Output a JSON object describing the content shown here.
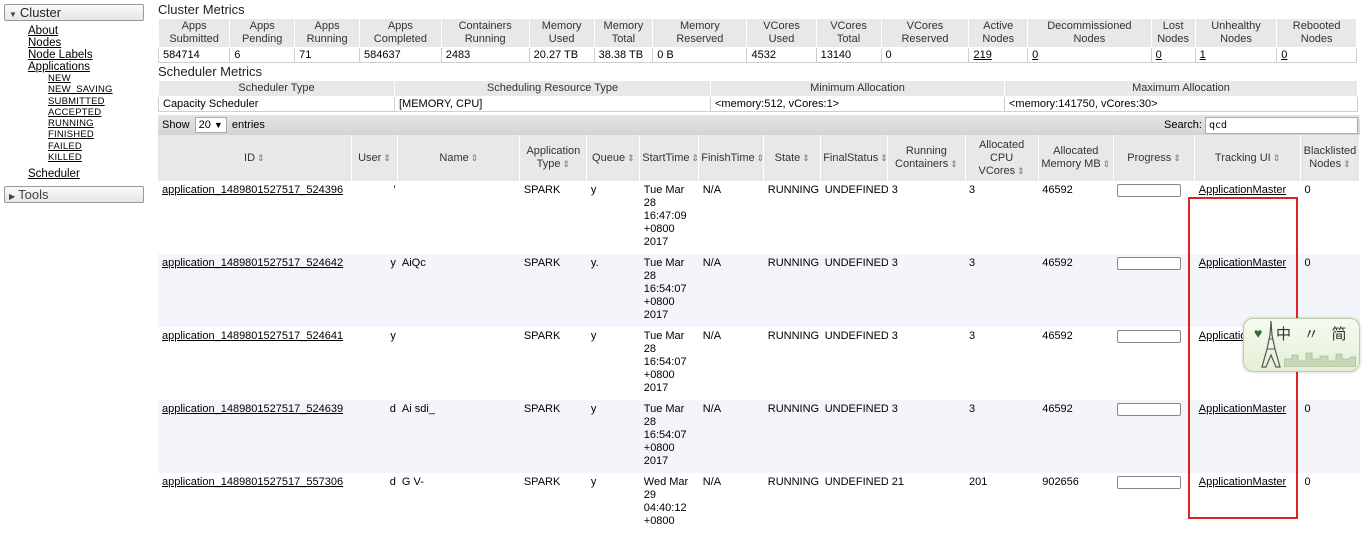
{
  "sidebar": {
    "cluster_label": "Cluster",
    "links": [
      "About",
      "Nodes",
      "Node Labels",
      "Applications"
    ],
    "app_states": [
      "NEW",
      "NEW_SAVING",
      "SUBMITTED",
      "ACCEPTED",
      "RUNNING",
      "FINISHED",
      "FAILED",
      "KILLED"
    ],
    "scheduler_link": "Scheduler",
    "tools_label": "Tools"
  },
  "cluster_metrics": {
    "title": "Cluster Metrics",
    "headers": [
      "Apps Submitted",
      "Apps Pending",
      "Apps Running",
      "Apps Completed",
      "Containers Running",
      "Memory Used",
      "Memory Total",
      "Memory Reserved",
      "VCores Used",
      "VCores Total",
      "VCores Reserved",
      "Active Nodes",
      "Decommissioned Nodes",
      "Lost Nodes",
      "Unhealthy Nodes",
      "Rebooted Nodes"
    ],
    "values": [
      "584714",
      "6",
      "71",
      "584637",
      "2483",
      "20.27 TB",
      "38.38 TB",
      "0 B",
      "4532",
      "13140",
      "0",
      "219",
      "0",
      "0",
      "1",
      "0"
    ]
  },
  "scheduler_metrics": {
    "title": "Scheduler Metrics",
    "headers": [
      "Scheduler Type",
      "Scheduling Resource Type",
      "Minimum Allocation",
      "Maximum Allocation"
    ],
    "values": [
      "Capacity Scheduler",
      "[MEMORY, CPU]",
      "<memory:512, vCores:1>",
      "<memory:141750, vCores:30>"
    ]
  },
  "apps_table": {
    "show_label": "Show",
    "entries_value": "20",
    "entries_label": "entries",
    "search_label": "Search:",
    "search_value": "qcd",
    "headers": [
      "ID",
      "User",
      "Name",
      "Application Type",
      "Queue",
      "StartTime",
      "FinishTime",
      "State",
      "FinalStatus",
      "Running Containers",
      "Allocated CPU VCores",
      "Allocated Memory MB",
      "Progress",
      "Tracking UI",
      "Blacklisted Nodes"
    ],
    "rows": [
      {
        "id": "application_1489801527517_524396",
        "user": "’",
        "name": "",
        "type": "SPARK",
        "queue": "y",
        "start": "Tue Mar 28 16:47:09 +0800 2017",
        "finish": "N/A",
        "state": "RUNNING",
        "final": "UNDEFINED",
        "containers": "3",
        "vcores": "3",
        "memory": "46592",
        "progress": 0.0,
        "tracking": "ApplicationMaster",
        "blacklisted": "0"
      },
      {
        "id": "application_1489801527517_524642",
        "user": "y",
        "name": "AiQc",
        "type": "SPARK",
        "queue": "y.",
        "start": "Tue Mar 28 16:54:07 +0800 2017",
        "finish": "N/A",
        "state": "RUNNING",
        "final": "UNDEFINED",
        "containers": "3",
        "vcores": "3",
        "memory": "46592",
        "progress": 0.0,
        "tracking": "ApplicationMaster",
        "blacklisted": "0"
      },
      {
        "id": "application_1489801527517_524641",
        "user": "y",
        "name": "",
        "type": "SPARK",
        "queue": "y",
        "start": "Tue Mar 28 16:54:07 +0800 2017",
        "finish": "N/A",
        "state": "RUNNING",
        "final": "UNDEFINED",
        "containers": "3",
        "vcores": "3",
        "memory": "46592",
        "progress": 0.0,
        "tracking": "Application",
        "blacklisted": ""
      },
      {
        "id": "application_1489801527517_524639",
        "user": "d",
        "name": "Ai sdi_",
        "type": "SPARK",
        "queue": "y",
        "start": "Tue Mar 28 16:54:07 +0800 2017",
        "finish": "N/A",
        "state": "RUNNING",
        "final": "UNDEFINED",
        "containers": "3",
        "vcores": "3",
        "memory": "46592",
        "progress": 0.0,
        "tracking": "ApplicationMaster",
        "blacklisted": "0"
      },
      {
        "id": "application_1489801527517_557306",
        "user": "d",
        "name": "G V-",
        "type": "SPARK",
        "queue": "y",
        "start": "Wed Mar 29 04:40:12 +0800",
        "finish": "N/A",
        "state": "RUNNING",
        "final": "UNDEFINED",
        "containers": "21",
        "vcores": "201",
        "memory": "902656",
        "progress": 0.0,
        "tracking": "ApplicationMaster",
        "blacklisted": "0"
      }
    ]
  },
  "badge": {
    "text": "中 〃 简"
  },
  "colors": {
    "highlight": "#e22222",
    "header_bg": "#e8e8e8",
    "even_row": "#f4f4fb"
  }
}
